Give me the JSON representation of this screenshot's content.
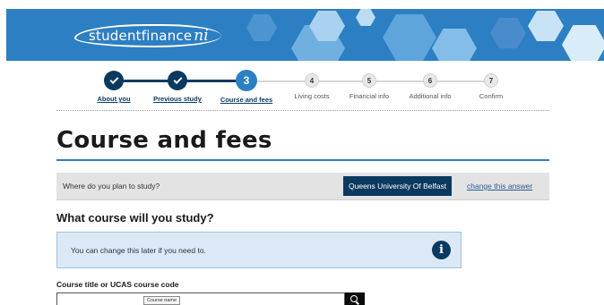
{
  "header": {
    "logo_text": "studentfinance",
    "logo_suffix": "ni"
  },
  "stepper": {
    "steps": [
      {
        "number": "1",
        "label": "About you",
        "state": "done"
      },
      {
        "number": "2",
        "label": "Previous study",
        "state": "done"
      },
      {
        "number": "3",
        "label": "Course and fees",
        "state": "current"
      },
      {
        "number": "4",
        "label": "Living costs",
        "state": "todo"
      },
      {
        "number": "5",
        "label": "Financial info",
        "state": "todo"
      },
      {
        "number": "6",
        "label": "Additional info",
        "state": "todo"
      },
      {
        "number": "7",
        "label": "Confirm",
        "state": "todo"
      }
    ]
  },
  "main": {
    "title": "Course and fees",
    "answer": {
      "question": "Where do you plan to study?",
      "value": "Queens University Of Belfast",
      "change_link": "change this answer"
    },
    "subheading": "What course will you study?",
    "info": {
      "text": "You can change this later if you need to.",
      "icon_glyph": "i"
    },
    "course_field": {
      "label": "Course title or UCAS course code",
      "value": "",
      "tooltip": "Course name"
    }
  },
  "colors": {
    "brand_blue": "#2d7fc3",
    "navy": "#0b3a60",
    "info_bg": "#dbe9f6",
    "answer_bg": "#e3e3e3"
  }
}
